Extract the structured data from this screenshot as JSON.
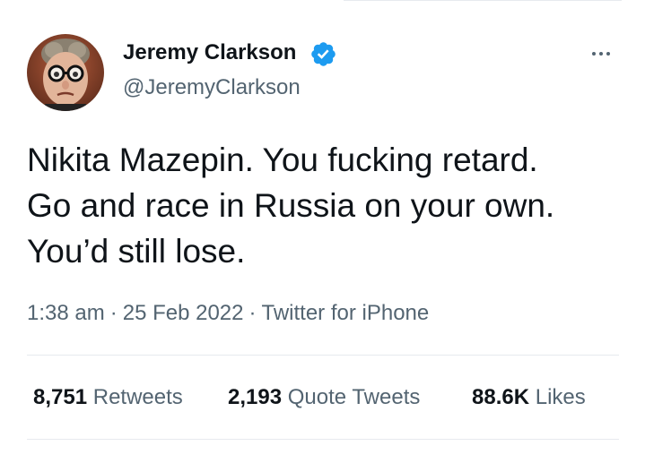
{
  "author": {
    "display_name": "Jeremy Clarkson",
    "handle": "@JeremyClarkson",
    "verified_icon": "verified-badge-icon",
    "avatar_icon": "avatar"
  },
  "tweet": {
    "lines": [
      "Nikita Mazepin. You fucking retard.",
      "Go and race in Russia on your own.",
      "You’d still lose."
    ]
  },
  "meta": {
    "time": "1:38 am",
    "separator": "·",
    "date": "25 Feb 2022",
    "source": "Twitter for iPhone"
  },
  "stats": {
    "retweets": {
      "count": "8,751",
      "label": "Retweets"
    },
    "quotes": {
      "count": "2,193",
      "label": "Quote Tweets"
    },
    "likes": {
      "count": "88.6K",
      "label": "Likes"
    }
  },
  "colors": {
    "text": "#0f1419",
    "secondary": "#536471",
    "verified": "#1d9bf0",
    "divider": "#e7eaee"
  }
}
